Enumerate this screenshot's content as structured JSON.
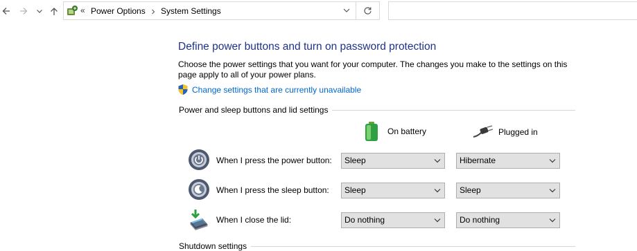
{
  "address_bar": {
    "breadcrumbs": [
      "Power Options",
      "System Settings"
    ],
    "overflow_glyph": "«"
  },
  "search": {
    "placeholder": ""
  },
  "page": {
    "title": "Define power buttons and turn on password protection",
    "description": "Choose the power settings that you want for your computer. The changes you make to the settings on this page apply to all of your power plans.",
    "uac_link": "Change settings that are currently unavailable"
  },
  "power_group": {
    "title": "Power and sleep buttons and lid settings",
    "columns": {
      "battery": "On battery",
      "plugged": "Plugged in"
    },
    "rows": [
      {
        "label": "When I press the power button:",
        "battery": "Sleep",
        "plugged": "Hibernate",
        "icon": "power-button-icon"
      },
      {
        "label": "When I press the sleep button:",
        "battery": "Sleep",
        "plugged": "Sleep",
        "icon": "sleep-button-icon"
      },
      {
        "label": "When I close the lid:",
        "battery": "Do nothing",
        "plugged": "Do nothing",
        "icon": "laptop-lid-icon"
      }
    ]
  },
  "shutdown_group": {
    "title": "Shutdown settings"
  },
  "colors": {
    "title": "#1e3287",
    "link": "#0066cc",
    "battery_green": "#2ea043"
  }
}
